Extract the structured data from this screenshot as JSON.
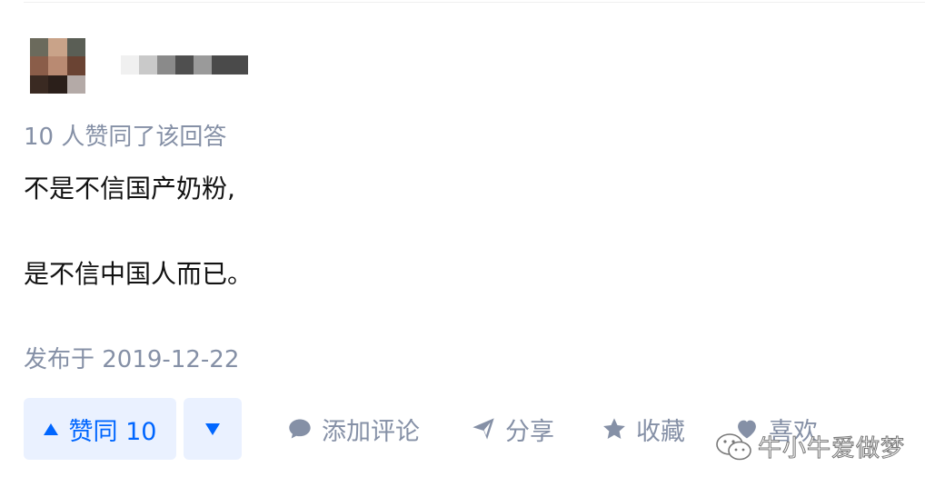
{
  "answer": {
    "vote_summary": "10 人赞同了该回答",
    "content_line1": "不是不信国产奶粉,",
    "content_line2": "是不信中国人而已。",
    "publish_time": "发布于 2019-12-22"
  },
  "actions": {
    "vote_up_label": "赞同 10",
    "comment_label": "添加评论",
    "share_label": "分享",
    "collect_label": "收藏",
    "like_label": "喜欢"
  },
  "watermark": {
    "text": "牛小牛爱做梦",
    "icon": "wechat-icon"
  },
  "icons": {
    "comment": "comment-bubble-icon",
    "share": "paper-plane-icon",
    "collect": "star-icon",
    "like": "heart-icon",
    "vote_up": "triangle-up-icon",
    "vote_down": "triangle-down-icon"
  },
  "colors": {
    "accent": "#0066ff",
    "accent_bg": "#eaf1ff",
    "muted": "#8590a6",
    "text": "#121212"
  }
}
